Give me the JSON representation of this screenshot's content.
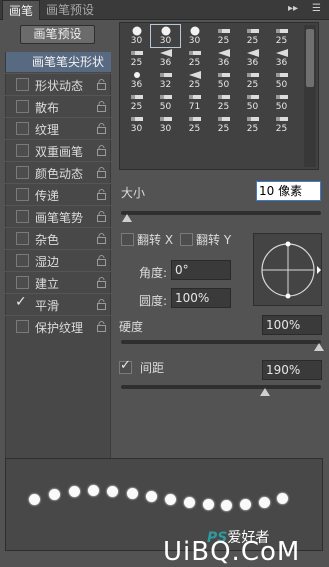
{
  "tabs": {
    "active": "画笔",
    "inactive": "画笔预设"
  },
  "presets_button": "画笔预设",
  "brush_tip_shape": "画笔笔尖形状",
  "options": [
    {
      "label": "形状动态",
      "checked": false
    },
    {
      "label": "散布",
      "checked": false
    },
    {
      "label": "纹理",
      "checked": false
    },
    {
      "label": "双重画笔",
      "checked": false
    },
    {
      "label": "颜色动态",
      "checked": false
    },
    {
      "label": "传递",
      "checked": false
    },
    {
      "label": "画笔笔势",
      "checked": false
    },
    {
      "label": "杂色",
      "checked": false
    },
    {
      "label": "湿边",
      "checked": false
    },
    {
      "label": "建立",
      "checked": false
    },
    {
      "label": "平滑",
      "checked": true
    },
    {
      "label": "保护纹理",
      "checked": false
    }
  ],
  "brush_grid": [
    "30",
    "30",
    "30",
    "25",
    "25",
    "25",
    "25",
    "36",
    "25",
    "36",
    "36",
    "36",
    "36",
    "32",
    "25",
    "50",
    "25",
    "50",
    "25",
    "50",
    "71",
    "25",
    "50",
    "50",
    "30",
    "30",
    "25",
    "25",
    "25",
    "25"
  ],
  "brush_grid_selected_index": 1,
  "size": {
    "label": "大小",
    "value": "10 像素"
  },
  "flip_x": {
    "label": "翻转 X",
    "checked": false
  },
  "flip_y": {
    "label": "翻转 Y",
    "checked": false
  },
  "angle": {
    "label": "角度:",
    "value": "0°"
  },
  "roundness": {
    "label": "圆度:",
    "value": "100%"
  },
  "hardness": {
    "label": "硬度",
    "value": "100%"
  },
  "spacing": {
    "label": "间距",
    "value": "190%",
    "checked": true
  },
  "watermark": {
    "ps": "PS",
    "cn": "爱好者",
    "site": "UiBQ.CoM"
  }
}
